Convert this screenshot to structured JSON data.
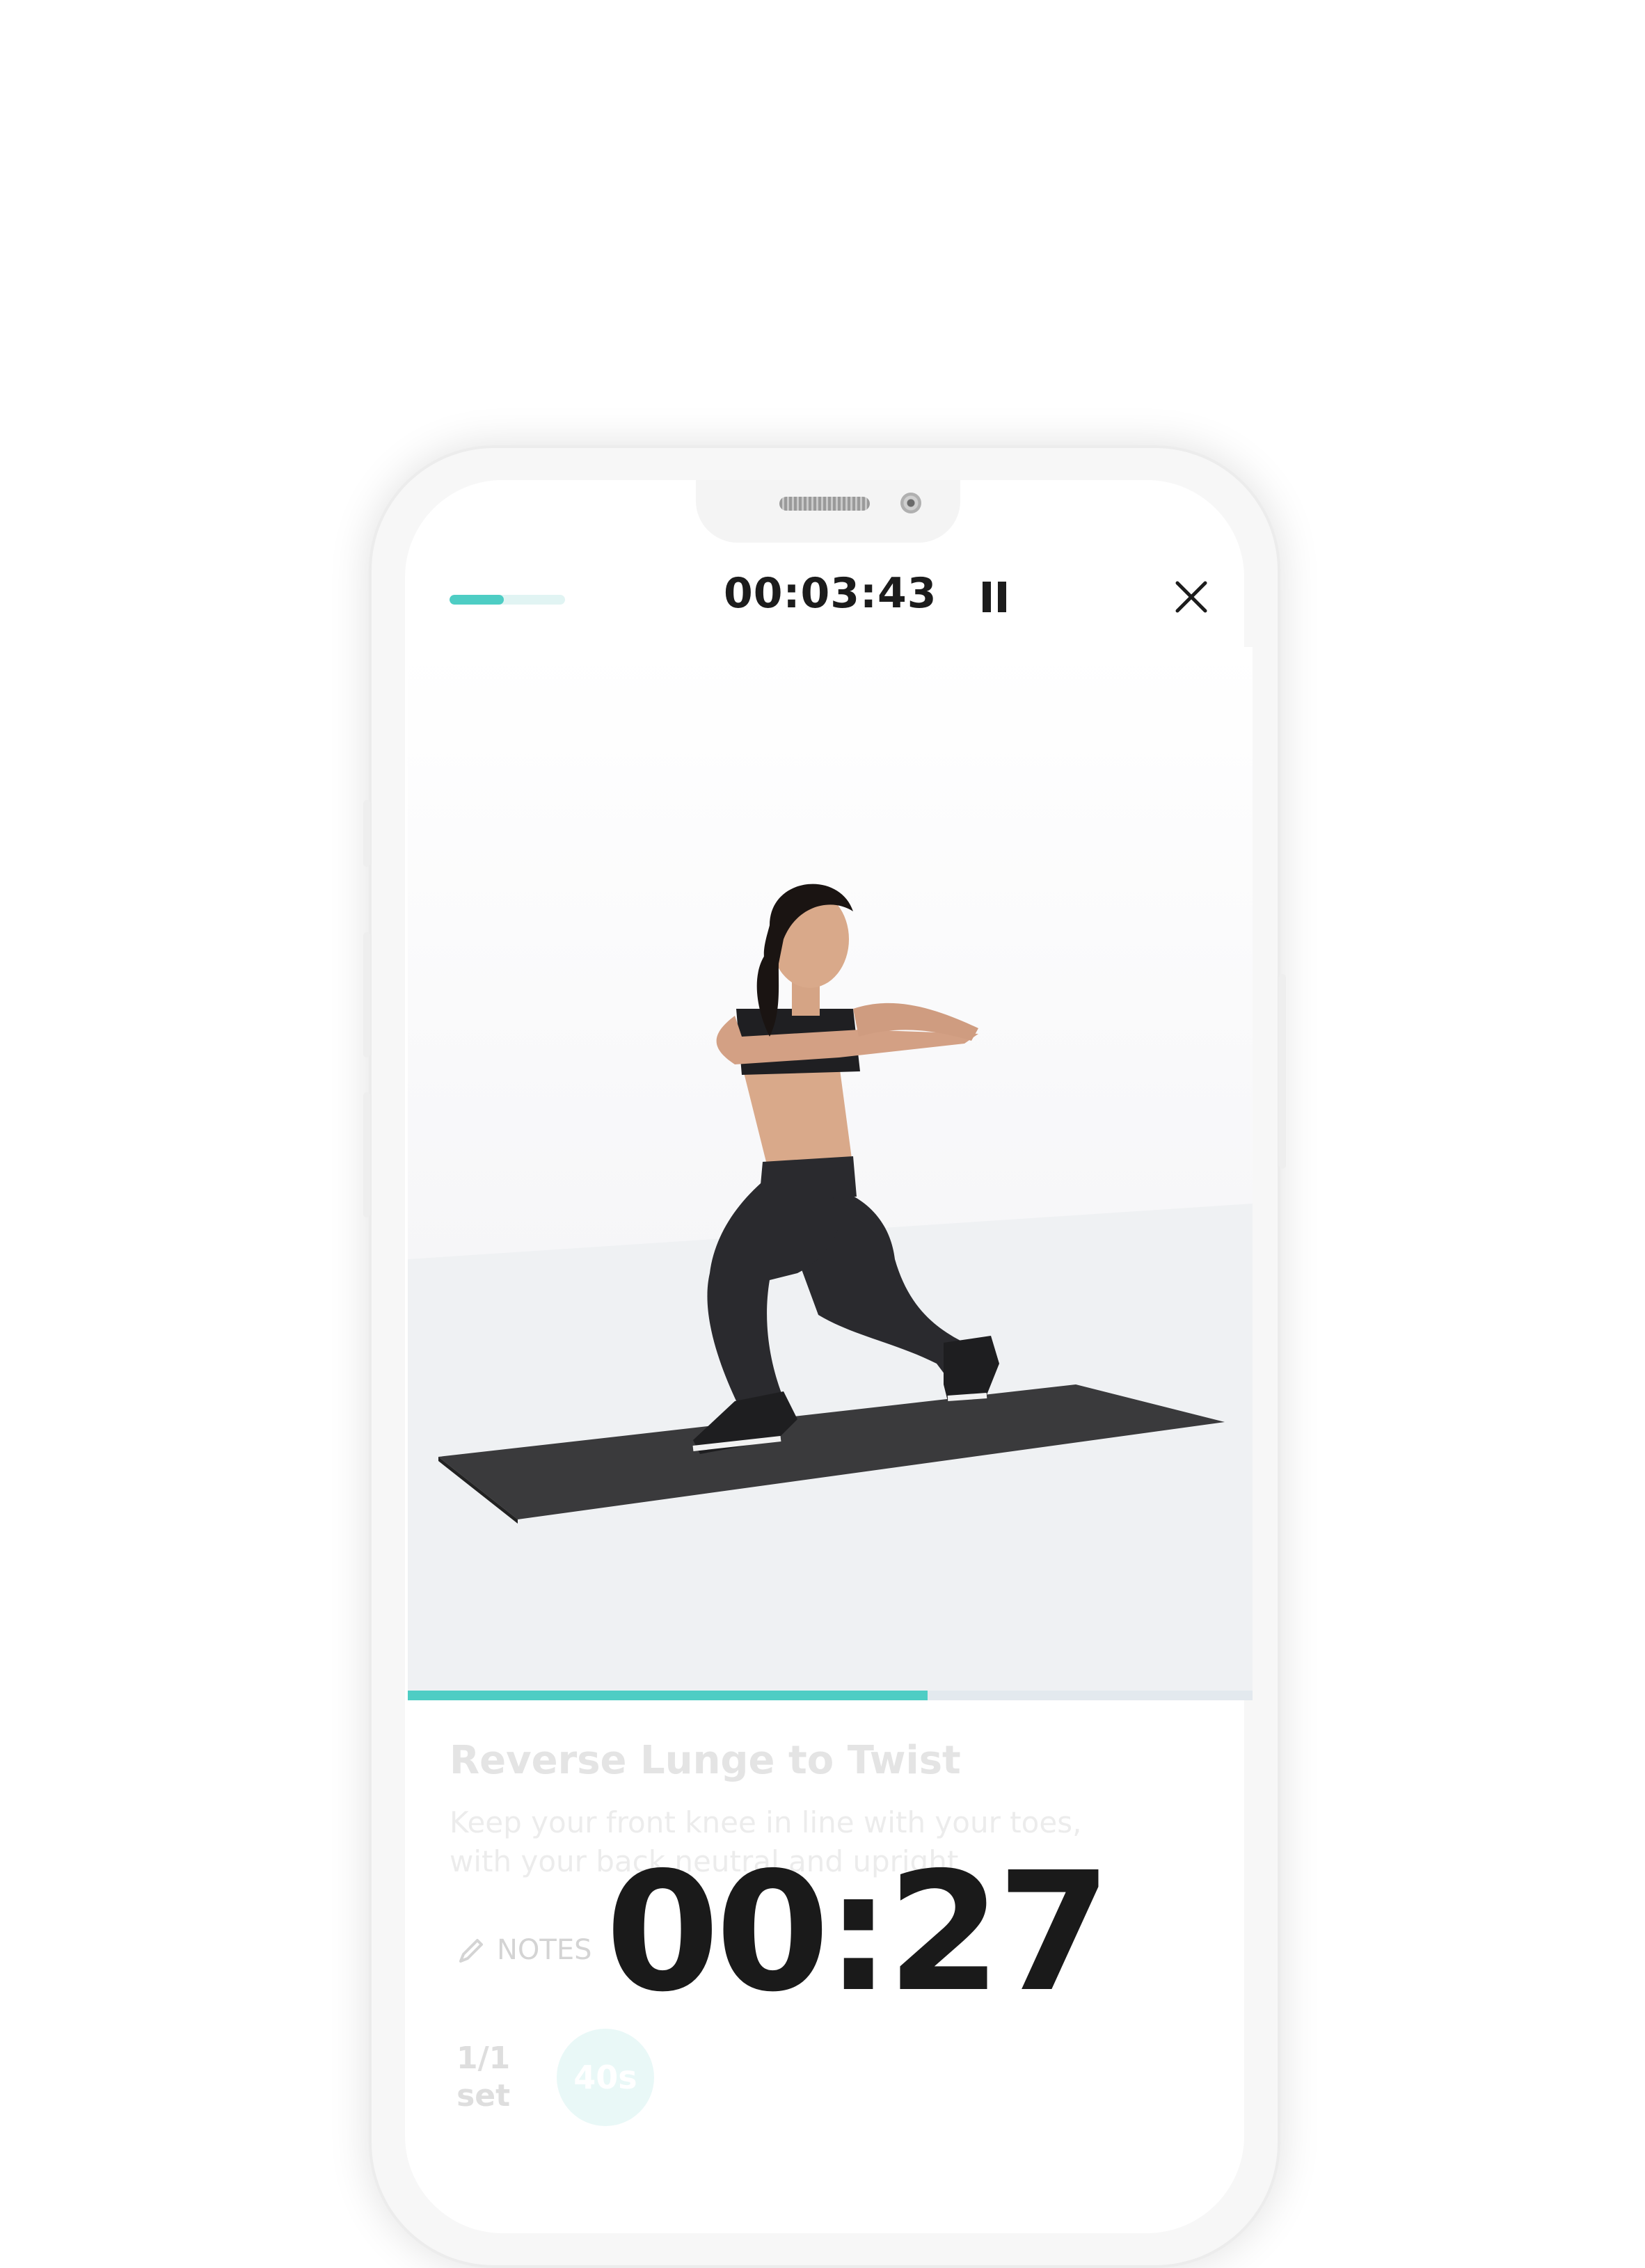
{
  "header": {
    "workout_progress": 0.47,
    "elapsed_time": "00:03:43",
    "pause_icon": "pause-icon",
    "close_icon": "close-icon"
  },
  "video": {
    "playback_progress": 0.615
  },
  "exercise": {
    "title": "Reverse Lunge to Twist",
    "description": "Keep your front knee in line with your toes, with your back neutral and upright",
    "notes_label": "NOTES",
    "notes_icon": "pencil-icon",
    "countdown": "00:27",
    "set_count": "1/1",
    "set_label": "set",
    "duration": "40s"
  },
  "colors": {
    "accent": "#4ecdc4",
    "accent_light": "#e1f4f3",
    "text_dark": "#1c1c1c"
  }
}
